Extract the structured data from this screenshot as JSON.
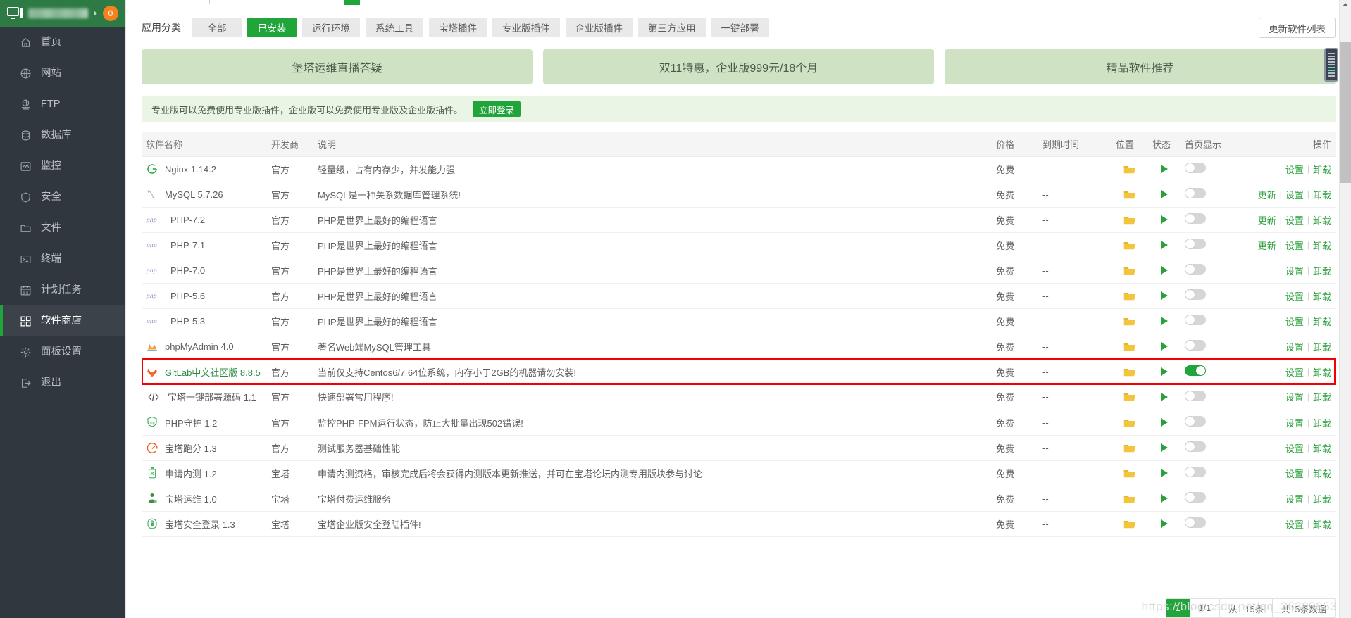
{
  "sidebar": {
    "header": {
      "icon": "monitor-icon",
      "username_blurred": true,
      "badge": "0"
    },
    "items": [
      {
        "label": "首页",
        "icon": "home-icon",
        "active": false
      },
      {
        "label": "网站",
        "icon": "globe-icon",
        "active": false
      },
      {
        "label": "FTP",
        "icon": "ftp-icon",
        "active": false
      },
      {
        "label": "数据库",
        "icon": "database-icon",
        "active": false
      },
      {
        "label": "监控",
        "icon": "chart-icon",
        "active": false
      },
      {
        "label": "安全",
        "icon": "shield-icon",
        "active": false
      },
      {
        "label": "文件",
        "icon": "folder-icon",
        "active": false
      },
      {
        "label": "终端",
        "icon": "terminal-icon",
        "active": false
      },
      {
        "label": "计划任务",
        "icon": "calendar-icon",
        "active": false
      },
      {
        "label": "软件商店",
        "icon": "grid-icon",
        "active": true
      },
      {
        "label": "面板设置",
        "icon": "gear-icon",
        "active": false
      },
      {
        "label": "退出",
        "icon": "logout-icon",
        "active": false
      }
    ]
  },
  "filterbar": {
    "label": "应用分类",
    "chips": [
      {
        "label": "全部",
        "active": false
      },
      {
        "label": "已安装",
        "active": true
      },
      {
        "label": "运行环境",
        "active": false
      },
      {
        "label": "系统工具",
        "active": false
      },
      {
        "label": "宝塔插件",
        "active": false
      },
      {
        "label": "专业版插件",
        "active": false
      },
      {
        "label": "企业版插件",
        "active": false
      },
      {
        "label": "第三方应用",
        "active": false
      },
      {
        "label": "一键部署",
        "active": false
      }
    ],
    "update_button": "更新软件列表"
  },
  "banners": [
    {
      "label": "堡塔运维直播答疑"
    },
    {
      "label": "双11特惠，企业版999元/18个月"
    },
    {
      "label": "精品软件推荐"
    }
  ],
  "notice": {
    "text": "专业版可以免费使用专业版插件，企业版可以免费使用专业版及企业版插件。",
    "button": "立即登录"
  },
  "table": {
    "headers": {
      "name": "软件名称",
      "developer": "开发商",
      "description": "说明",
      "price": "价格",
      "expiry": "到期时间",
      "location": "位置",
      "status": "状态",
      "homepage": "首页显示",
      "actions": "操作"
    },
    "action_labels": {
      "update": "更新",
      "settings": "设置",
      "uninstall": "卸载",
      "separator": "|"
    },
    "rows": [
      {
        "icon": "nginx-icon",
        "name": "Nginx 1.14.2",
        "developer": "官方",
        "description": "轻量级，占有内存少，并发能力强",
        "price": "免费",
        "expiry": "--",
        "location": "folder-icon",
        "status": "play-icon",
        "homepage_on": false,
        "actions": [
          "设置",
          "卸载"
        ]
      },
      {
        "icon": "mysql-icon",
        "name": "MySQL 5.7.26",
        "developer": "官方",
        "description": "MySQL是一种关系数据库管理系统!",
        "price": "免费",
        "expiry": "--",
        "location": "folder-icon",
        "status": "play-icon",
        "homepage_on": false,
        "actions": [
          "更新",
          "设置",
          "卸载"
        ]
      },
      {
        "icon": "php-icon",
        "name": "PHP-7.2",
        "developer": "官方",
        "description": "PHP是世界上最好的编程语言",
        "price": "免费",
        "expiry": "--",
        "location": "folder-icon",
        "status": "play-icon",
        "homepage_on": false,
        "actions": [
          "更新",
          "设置",
          "卸载"
        ]
      },
      {
        "icon": "php-icon",
        "name": "PHP-7.1",
        "developer": "官方",
        "description": "PHP是世界上最好的编程语言",
        "price": "免费",
        "expiry": "--",
        "location": "folder-icon",
        "status": "play-icon",
        "homepage_on": false,
        "actions": [
          "更新",
          "设置",
          "卸载"
        ]
      },
      {
        "icon": "php-icon",
        "name": "PHP-7.0",
        "developer": "官方",
        "description": "PHP是世界上最好的编程语言",
        "price": "免费",
        "expiry": "--",
        "location": "folder-icon",
        "status": "play-icon",
        "homepage_on": false,
        "actions": [
          "设置",
          "卸载"
        ]
      },
      {
        "icon": "php-icon",
        "name": "PHP-5.6",
        "developer": "官方",
        "description": "PHP是世界上最好的编程语言",
        "price": "免费",
        "expiry": "--",
        "location": "folder-icon",
        "status": "play-icon",
        "homepage_on": false,
        "actions": [
          "设置",
          "卸载"
        ]
      },
      {
        "icon": "php-icon",
        "name": "PHP-5.3",
        "developer": "官方",
        "description": "PHP是世界上最好的编程语言",
        "price": "免费",
        "expiry": "--",
        "location": "folder-icon",
        "status": "play-icon",
        "homepage_on": false,
        "actions": [
          "设置",
          "卸载"
        ]
      },
      {
        "icon": "phpmyadmin-icon",
        "name": "phpMyAdmin 4.0",
        "developer": "官方",
        "description": "著名Web端MySQL管理工具",
        "price": "免费",
        "expiry": "--",
        "location": "folder-icon",
        "status": "play-icon",
        "homepage_on": false,
        "actions": [
          "设置",
          "卸载"
        ]
      },
      {
        "icon": "gitlab-icon",
        "name": "GitLab中文社区版 8.8.5",
        "developer": "官方",
        "description": "当前仅支持Centos6/7 64位系统，内存小于2GB的机器请勿安装!",
        "price": "免费",
        "expiry": "--",
        "location": "folder-icon",
        "status": "play-icon",
        "homepage_on": true,
        "highlighted": true,
        "actions": [
          "设置",
          "卸载"
        ]
      },
      {
        "icon": "code-icon",
        "name": "宝塔一键部署源码 1.1",
        "developer": "官方",
        "description": "快速部署常用程序!",
        "price": "免费",
        "expiry": "--",
        "location": "folder-icon",
        "status": "play-icon",
        "homepage_on": false,
        "actions": [
          "设置",
          "卸载"
        ]
      },
      {
        "icon": "php-shield-icon",
        "name": "PHP守护 1.2",
        "developer": "官方",
        "description": "监控PHP-FPM运行状态，防止大批量出现502错误!",
        "price": "免费",
        "expiry": "--",
        "location": "folder-icon",
        "status": "play-icon",
        "homepage_on": false,
        "actions": [
          "设置",
          "卸载"
        ]
      },
      {
        "icon": "speedometer-icon",
        "name": "宝塔跑分 1.3",
        "developer": "官方",
        "description": "测试服务器基础性能",
        "price": "免费",
        "expiry": "--",
        "location": "folder-icon",
        "status": "play-icon",
        "homepage_on": false,
        "actions": [
          "设置",
          "卸载"
        ]
      },
      {
        "icon": "beta-icon",
        "name": "申请内测 1.2",
        "developer": "宝塔",
        "description": "申请内测资格，审核完成后将会获得内测版本更新推送，并可在宝塔论坛内测专用版块参与讨论",
        "price": "免费",
        "expiry": "--",
        "location": "folder-icon",
        "status": "play-icon",
        "homepage_on": false,
        "actions": [
          "设置",
          "卸载"
        ]
      },
      {
        "icon": "ops-icon",
        "name": "宝塔运维 1.0",
        "developer": "宝塔",
        "description": "宝塔付费运维服务",
        "price": "免费",
        "expiry": "--",
        "location": "folder-icon",
        "status": "play-icon",
        "homepage_on": false,
        "actions": [
          "设置",
          "卸载"
        ]
      },
      {
        "icon": "lock-icon",
        "name": "宝塔安全登录 1.3",
        "developer": "宝塔",
        "description": "宝塔企业版安全登陆插件!",
        "price": "免费",
        "expiry": "--",
        "location": "folder-icon",
        "status": "play-icon",
        "homepage_on": false,
        "actions": [
          "设置",
          "卸载"
        ]
      }
    ]
  },
  "pager": {
    "current": "1",
    "pages": "1/1",
    "range": "从1-15条",
    "total": "共15条数据"
  },
  "watermark": "https://blog.csdn.net/qq_36303853",
  "colors": {
    "brand_green": "#20a53a",
    "header_green": "#2d7a44",
    "sidebar_dark": "#31373e",
    "badge_orange": "#f1821f",
    "highlight_red": "#f50000",
    "banner_green": "#cfe3c4"
  }
}
